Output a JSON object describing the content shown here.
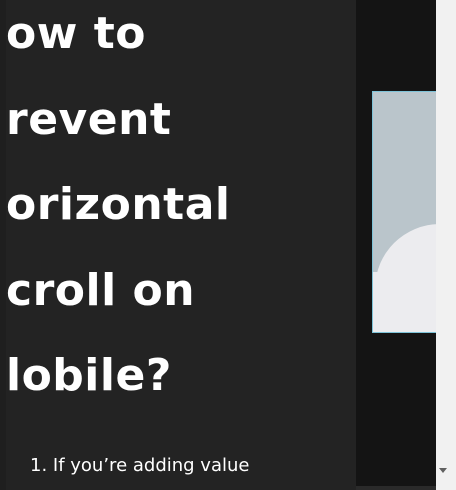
{
  "article": {
    "heading_lines": [
      "ow to",
      "revent",
      "orizontal",
      "croll on",
      "lobile?"
    ],
    "list_item_1": "1. If you’re adding value"
  },
  "icons": {
    "scroll_down": "chevron-down-icon"
  }
}
